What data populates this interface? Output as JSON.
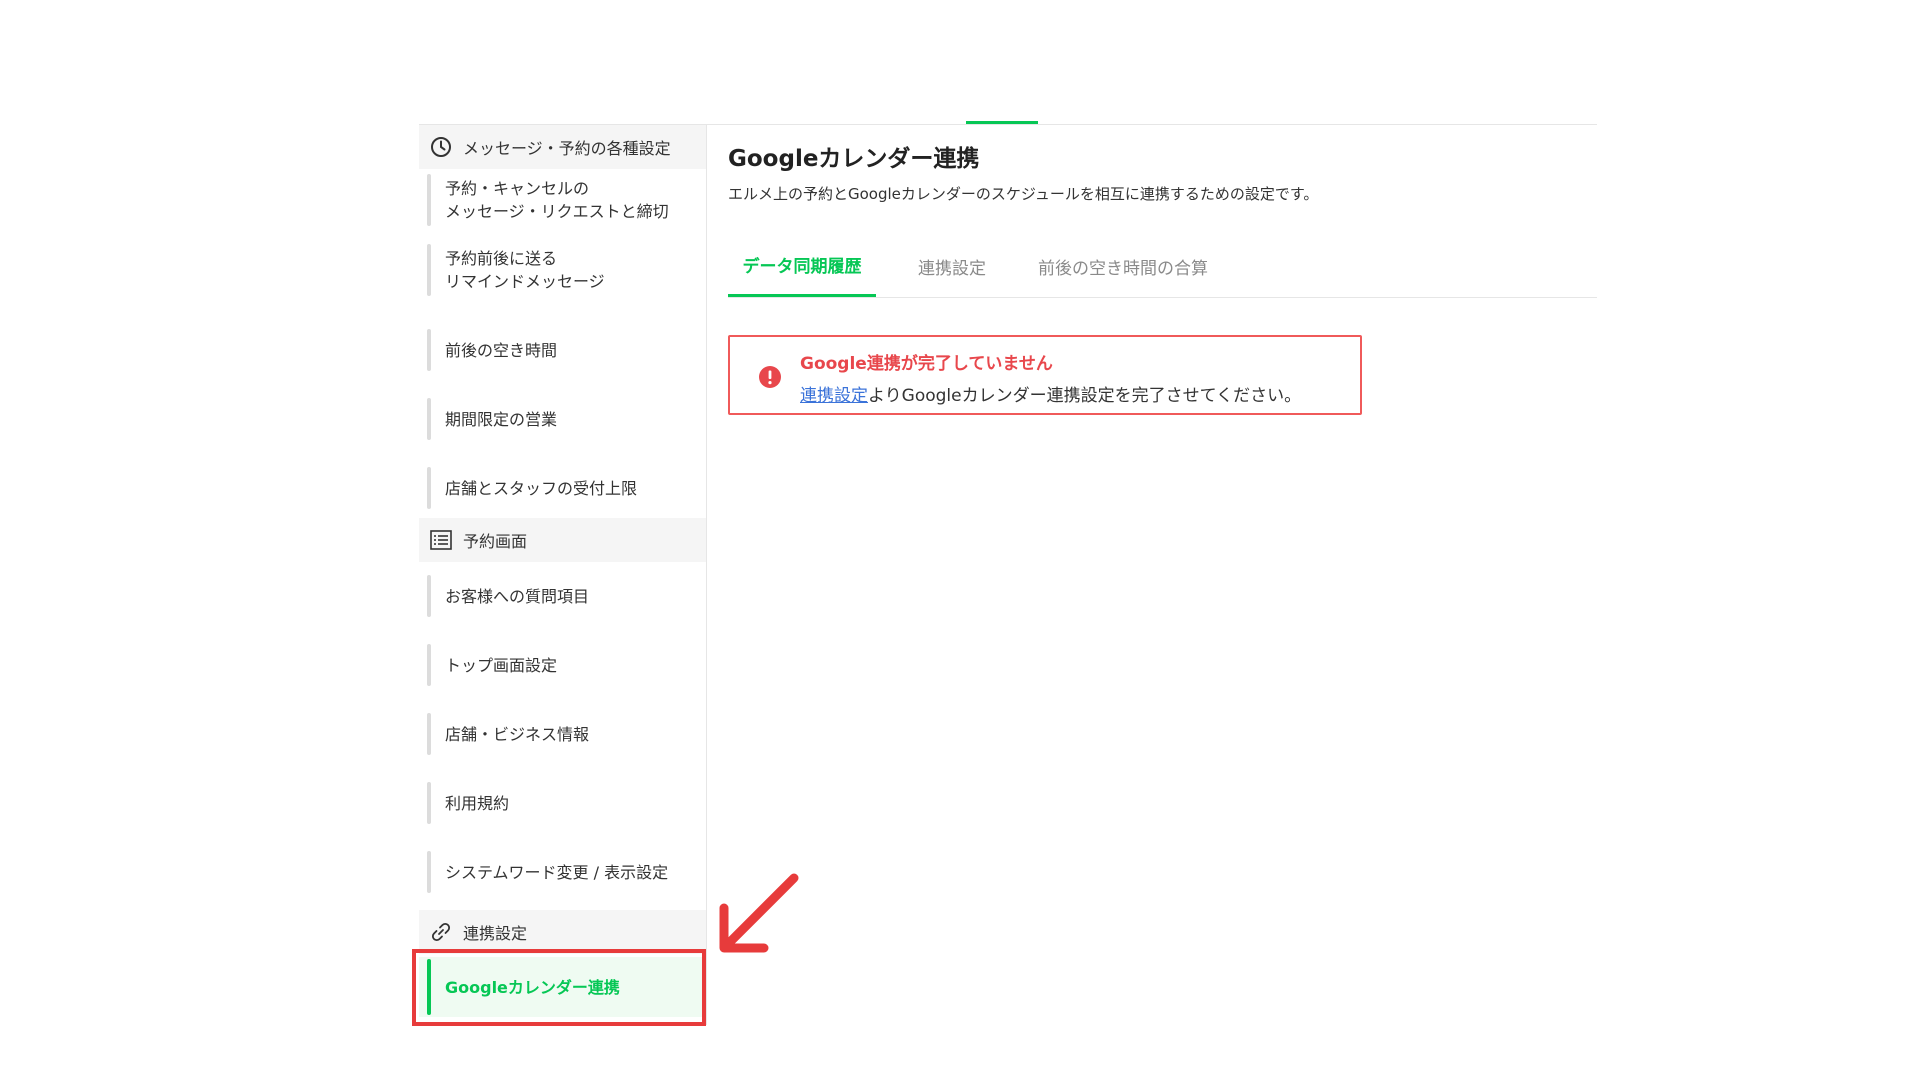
{
  "sidebar": {
    "sections": [
      {
        "icon": "clock-icon",
        "title": "メッセージ・予約の各種設定",
        "items": [
          {
            "label": "予約・キャンセルの\nメッセージ・リクエストと締切"
          },
          {
            "label": "予約前後に送る\nリマインドメッセージ"
          },
          {
            "label": "前後の空き時間"
          },
          {
            "label": "期間限定の営業"
          },
          {
            "label": "店舗とスタッフの受付上限"
          }
        ]
      },
      {
        "icon": "list-icon",
        "title": "予約画面",
        "items": [
          {
            "label": "お客様への質問項目"
          },
          {
            "label": "トップ画面設定"
          },
          {
            "label": "店舗・ビジネス情報"
          },
          {
            "label": "利用規約"
          },
          {
            "label": "システムワード変更 / 表示設定"
          }
        ]
      },
      {
        "icon": "link-icon",
        "title": "連携設定",
        "items": [
          {
            "label": "Googleカレンダー連携",
            "active": true
          }
        ]
      }
    ]
  },
  "main": {
    "title": "Googleカレンダー連携",
    "description": "エルメ上の予約とGoogleカレンダーのスケジュールを相互に連携するための設定です。",
    "tabs": [
      {
        "label": "データ同期履歴",
        "active": true
      },
      {
        "label": "連携設定"
      },
      {
        "label": "前後の空き時間の合算"
      }
    ],
    "alert": {
      "icon": "warning-icon",
      "title": "Google連携が完了していません",
      "link_text": "連携設定",
      "body_rest": "よりGoogleカレンダー連携設定を完了させてください。"
    }
  },
  "colors": {
    "accent": "#06c755",
    "alert": "#e8474c",
    "highlight": "#e73b3b",
    "link": "#3b73d9"
  }
}
